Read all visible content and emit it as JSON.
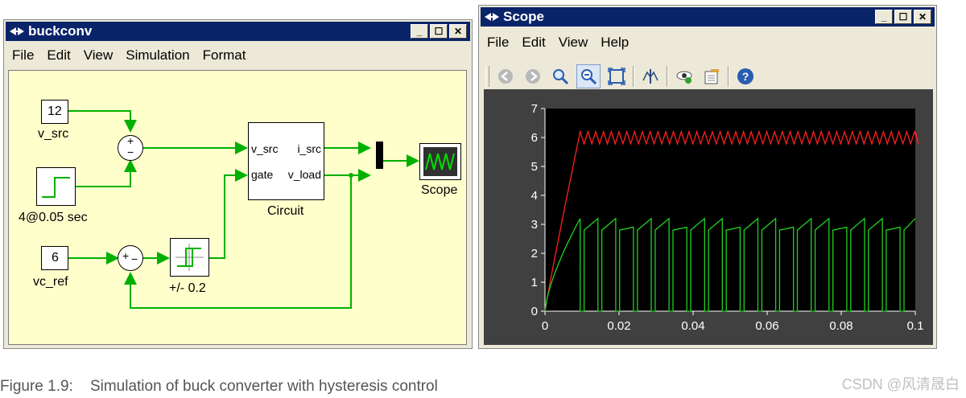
{
  "buckconv": {
    "title": "buckconv",
    "menu": [
      "File",
      "Edit",
      "View",
      "Simulation",
      "Format"
    ],
    "blocks": {
      "v_src_value": "12",
      "v_src_label": "v_src",
      "step_label": "4@0.05 sec",
      "vc_ref_value": "6",
      "vc_ref_label": "vc_ref",
      "hyst_label": "+/- 0.2",
      "circuit_label": "Circuit",
      "circuit_in1": "v_src",
      "circuit_in2": "gate",
      "circuit_out1": "i_src",
      "circuit_out2": "v_load",
      "scope_label": "Scope",
      "sum1_plus": "+",
      "sum1_minus": "−",
      "sum2_plus": "+",
      "sum2_minus": "−"
    }
  },
  "scope": {
    "title": "Scope",
    "menu": [
      "File",
      "Edit",
      "View",
      "Help"
    ],
    "toolbar_icons": [
      "back-icon",
      "forward-icon",
      "zoom-icon",
      "zoom-fit-icon",
      "zoom-box-icon",
      "cursor-icon",
      "view-icon",
      "properties-icon",
      "help-icon"
    ],
    "chart_data": {
      "type": "line",
      "title": "",
      "xlabel": "",
      "ylabel": "",
      "xlim": [
        0,
        0.1
      ],
      "ylim": [
        0,
        7
      ],
      "x_ticks": [
        "0",
        "0.02",
        "0.04",
        "0.06",
        "0.08",
        "0.1"
      ],
      "y_ticks": [
        "0",
        "1",
        "2",
        "3",
        "4",
        "5",
        "6",
        "7"
      ],
      "grid": false,
      "series": [
        {
          "color": "#ff2020",
          "description_values": "rise 0→6.2 by t≈0.0095, then ripple ≈5.8–6.2"
        },
        {
          "color": "#20d020",
          "description_values": "rise 0→3.2 by t≈0.0095, then switching pulses 0↔≈2.9–3.2"
        }
      ]
    }
  },
  "caption": "Figure 1.9:    Simulation of buck converter with hysteresis control",
  "watermark": "CSDN @风清晟白"
}
